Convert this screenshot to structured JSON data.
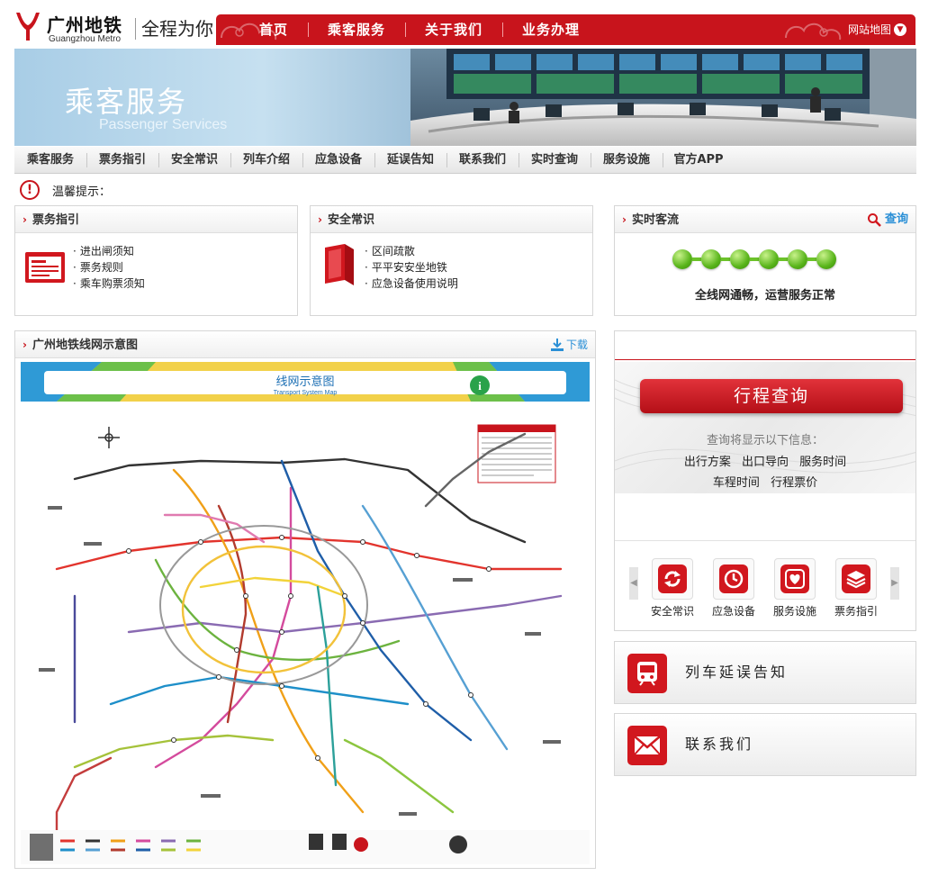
{
  "brand": {
    "name_cn": "广州地铁",
    "name_en": "Guangzhou Metro",
    "slogan": "全程为你",
    "accent_color": "#c8141c"
  },
  "topnav": {
    "items": [
      {
        "label": "首页"
      },
      {
        "label": "乘客服务"
      },
      {
        "label": "关于我们"
      },
      {
        "label": "业务办理"
      }
    ],
    "sitemap_label": "网站地图"
  },
  "banner": {
    "title": "乘客服务",
    "subtitle": "Passenger Services"
  },
  "subnav": {
    "items": [
      {
        "label": "乘客服务"
      },
      {
        "label": "票务指引"
      },
      {
        "label": "安全常识"
      },
      {
        "label": "列车介绍"
      },
      {
        "label": "应急设备"
      },
      {
        "label": "延误告知"
      },
      {
        "label": "联系我们"
      },
      {
        "label": "实时查询"
      },
      {
        "label": "服务设施"
      },
      {
        "label": "官方APP"
      }
    ]
  },
  "tip": {
    "label": "温馨提示："
  },
  "ticket_panel": {
    "title": "票务指引",
    "links": [
      "进出闸须知",
      "票务规则",
      "乘车购票须知"
    ]
  },
  "safety_panel": {
    "title": "安全常识",
    "links": [
      "区间疏散",
      "平平安安坐地铁",
      "应急设备使用说明"
    ]
  },
  "realtime_panel": {
    "title": "实时客流",
    "query_label": "查询",
    "dot_count": 6,
    "status": "全线网通畅，运营服务正常",
    "status_color": "#58b41a"
  },
  "map_panel": {
    "title": "广州地铁线网示意图",
    "download_label": "下载",
    "map_title_cn": "线网示意图",
    "map_title_en": "Transport System Map"
  },
  "trip_panel": {
    "button_label": "行程查询",
    "hint": "查询将显示以下信息：",
    "options_row1": [
      "出行方案",
      "出口导向",
      "服务时间"
    ],
    "options_row2": [
      "车程时间",
      "行程票价"
    ],
    "quick_links": [
      {
        "label": "安全常识",
        "icon": "refresh-icon"
      },
      {
        "label": "应急设备",
        "icon": "clock-icon"
      },
      {
        "label": "服务设施",
        "icon": "heart-icon"
      },
      {
        "label": "票务指引",
        "icon": "layers-icon"
      }
    ]
  },
  "delay_card": {
    "label": "列车延误告知",
    "icon": "train-icon"
  },
  "contact_card": {
    "label": "联系我们",
    "icon": "mail-icon"
  }
}
